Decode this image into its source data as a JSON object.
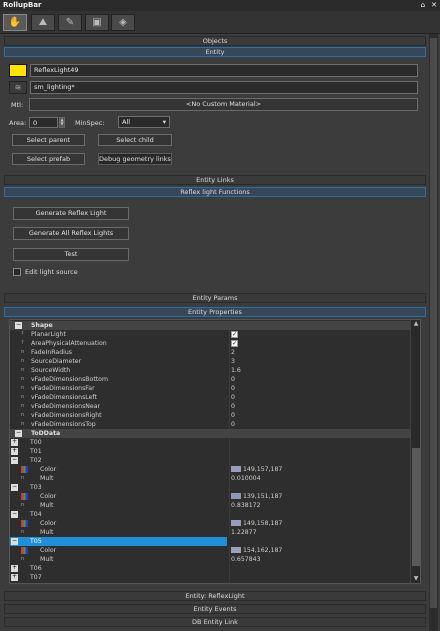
{
  "window": {
    "title": "RollupBar",
    "pin": "⌂",
    "close": "✕"
  },
  "toolbar": {
    "icons": [
      "objects-tab-icon",
      "terrain-tab-icon",
      "modelling-tab-icon",
      "display-tab-icon",
      "layers-tab-icon"
    ]
  },
  "sections": {
    "objects": "Objects",
    "entity": "Entity",
    "entity_links": "Entity Links",
    "reflex_functions": "Reflex light Functions",
    "entity_params": "Entity Params",
    "entity_properties": "Entity Properties",
    "entity_reflexlight": "Entity: ReflexLight",
    "entity_events": "Entity Events",
    "db_entity_link": "DB Entity Link"
  },
  "entity": {
    "name": "ReflexLight49",
    "layer": "sm_lighting*",
    "mtl_label": "Mtl:",
    "mtl_value": "<No Custom Material>",
    "area_label": "Area:",
    "area_value": "0",
    "minspec_label": "MinSpec:",
    "minspec_value": "All",
    "select_parent": "Select parent",
    "select_child": "Select child",
    "select_prefab": "Select prefab",
    "debug_geometry_links": "Debug geometry links",
    "color_swatch": "#ffe400"
  },
  "reflex": {
    "generate_reflex_light": "Generate Reflex Light",
    "generate_all_reflex_lights": "Generate All Reflex Lights",
    "test": "Test",
    "edit_light_source": "Edit light source"
  },
  "properties": {
    "shape_group": "Shape",
    "planar_light": "PlanarLight",
    "area_physical_attenuation": "AreaPhysicalAttenuation",
    "fade_in_radius": {
      "name": "FadeInRadius",
      "value": "2"
    },
    "source_diameter": {
      "name": "SourceDiameter",
      "value": "3"
    },
    "source_width": {
      "name": "SourceWidth",
      "value": "1.6"
    },
    "fade_bottom": {
      "name": "vFadeDimensionsBottom",
      "value": "0"
    },
    "fade_far": {
      "name": "vFadeDimensionsFar",
      "value": "0"
    },
    "fade_left": {
      "name": "vFadeDimensionsLeft",
      "value": "0"
    },
    "fade_near": {
      "name": "vFadeDimensionsNear",
      "value": "0"
    },
    "fade_right": {
      "name": "vFadeDimensionsRight",
      "value": "0"
    },
    "fade_top": {
      "name": "vFadeDimensionsTop",
      "value": "0"
    },
    "tod_group": "ToDData",
    "t00": "T00",
    "t01": "T01",
    "t02": "T02",
    "t02_color": "149,157,187",
    "t02_mult": "0.010004",
    "t03": "T03",
    "t03_color": "139,151,187",
    "t03_mult": "0.838172",
    "t04": "T04",
    "t04_color": "149,158,187",
    "t04_mult": "1.22877",
    "t05": "T05",
    "t05_color": "154,162,187",
    "t05_mult": "0.657843",
    "t06": "T06",
    "t07": "T07",
    "color_label": "Color",
    "mult_label": "Mult"
  }
}
